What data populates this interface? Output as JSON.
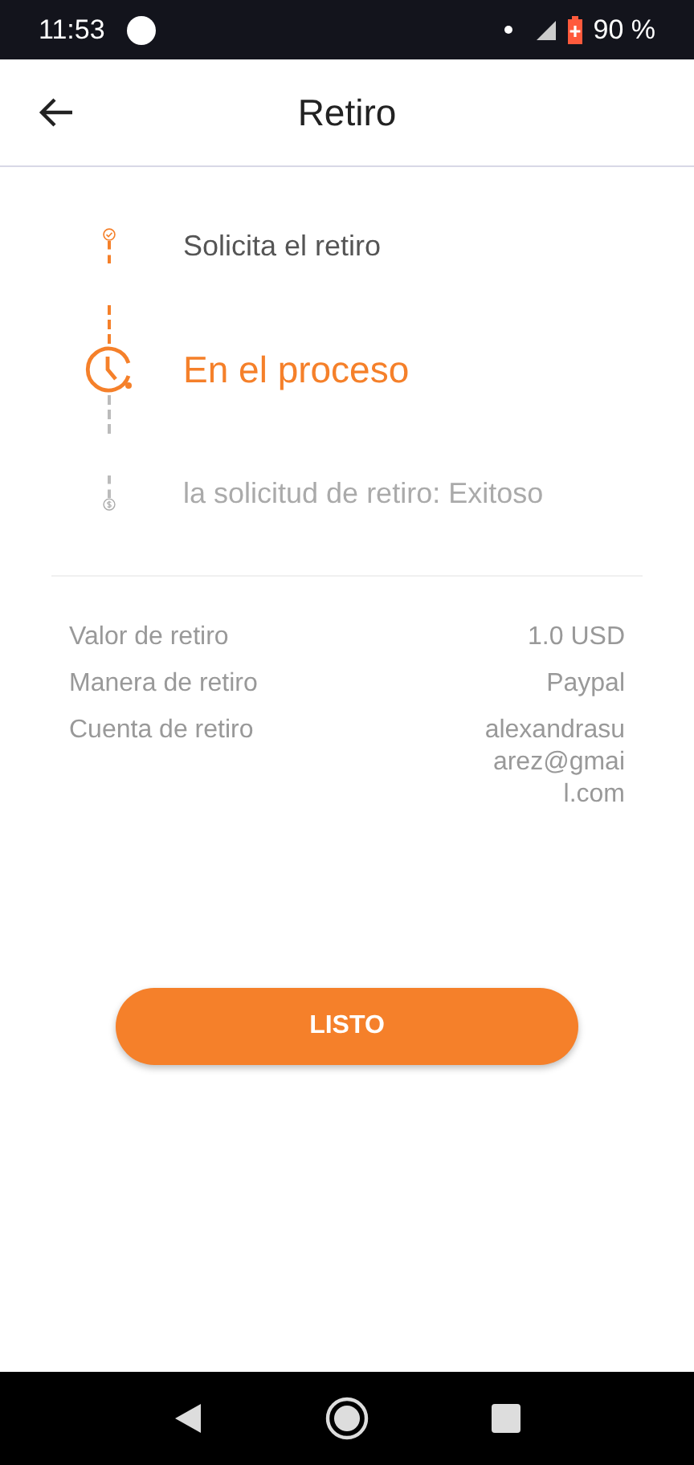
{
  "status_bar": {
    "time": "11:53",
    "battery": "90 %"
  },
  "header": {
    "title": "Retiro"
  },
  "steps": [
    {
      "label": "Solicita el retiro",
      "kind": "done"
    },
    {
      "label": "En el proceso",
      "kind": "current"
    },
    {
      "label": "la solicitud de retiro: Exitoso",
      "kind": "pending"
    }
  ],
  "details": [
    {
      "label": "Valor de retiro",
      "value": "1.0 USD"
    },
    {
      "label": "Manera de retiro",
      "value": "Paypal"
    },
    {
      "label": "Cuenta de retiro",
      "value": "alexandrasuarez@gmail.com"
    }
  ],
  "button": "LISTO"
}
